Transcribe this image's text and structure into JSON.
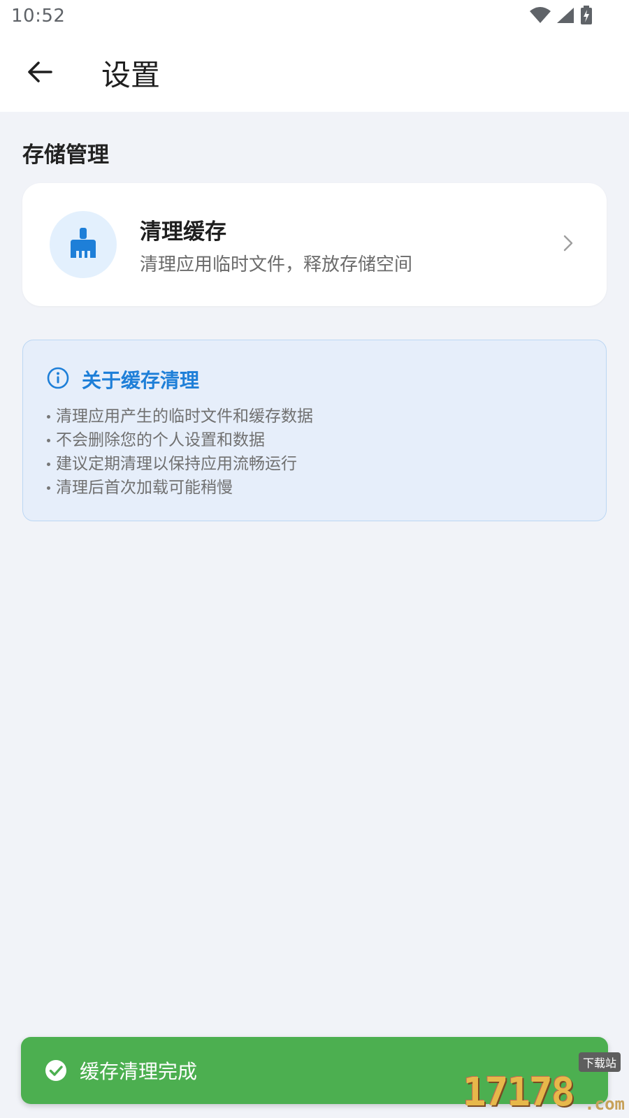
{
  "status_bar": {
    "time": "10:52",
    "icons": [
      "wifi-icon",
      "signal-icon",
      "battery-charging-icon"
    ]
  },
  "app_bar": {
    "back_icon": "arrow-left-icon",
    "title": "设置"
  },
  "storage_section": {
    "title": "存储管理",
    "clear_cache_item": {
      "icon": "broom-icon",
      "title": "清理缓存",
      "subtitle": "清理应用临时文件，释放存储空间",
      "chevron": "chevron-right-icon"
    }
  },
  "info_box": {
    "icon": "info-icon",
    "title": "关于缓存清理",
    "items": [
      "清理应用产生的临时文件和缓存数据",
      "不会删除您的个人设置和数据",
      "建议定期清理以保持应用流畅运行",
      "清理后首次加载可能稍慢"
    ]
  },
  "toast": {
    "icon": "check-circle-icon",
    "message": "缓存清理完成"
  },
  "watermark": {
    "digits": "17178",
    "badge": "下载站",
    "domain": ".com"
  },
  "colors": {
    "background": "#f1f3f8",
    "accent": "#1e7fd8",
    "icon_bg": "#e3f0fd",
    "info_bg": "#e6eefa",
    "info_border": "#bcd7f3",
    "success": "#4caf50"
  }
}
